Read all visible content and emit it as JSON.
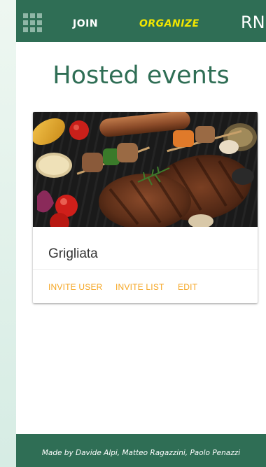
{
  "navbar": {
    "menu_icon": "grid-menu-icon",
    "join_label": "JOIN",
    "organize_label": "ORGANIZE",
    "brand": "RN"
  },
  "page": {
    "title": "Hosted events"
  },
  "event_card": {
    "image": "grilled-meats-photo",
    "title": "Grigliata",
    "actions": {
      "invite_user": "INVITE USER",
      "invite_list": "INVITE LIST",
      "edit": "EDIT"
    }
  },
  "footer": {
    "credits": "Made by Davide Alpi, Matteo Ragazzini, Paolo Penazzi"
  },
  "colors": {
    "primary": "#2f6e55",
    "active_nav": "#f2e600",
    "action": "#f5a623",
    "title": "#2f6e55"
  }
}
